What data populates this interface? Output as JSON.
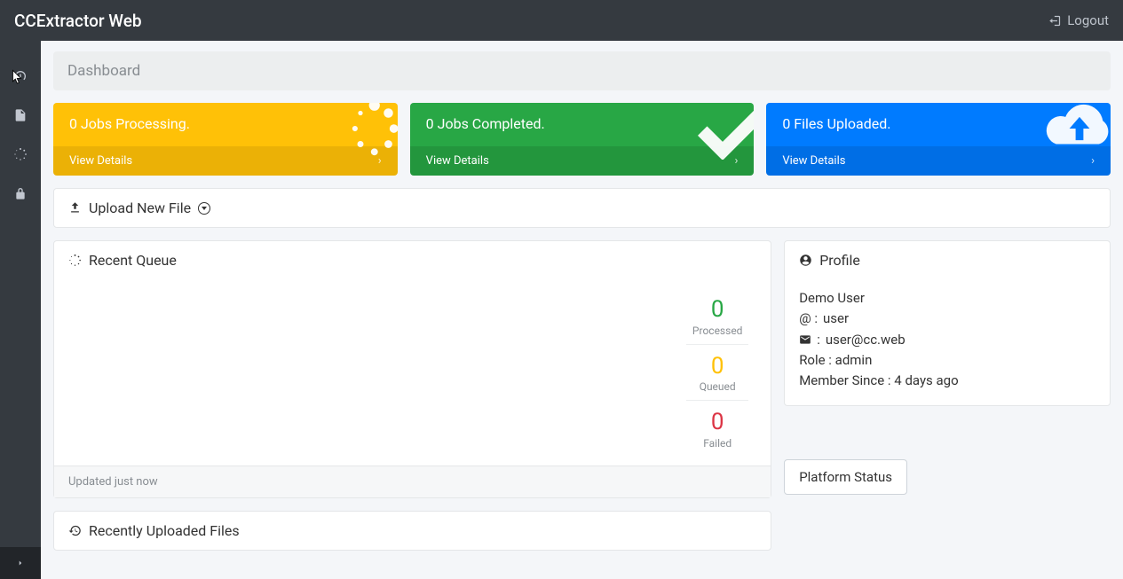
{
  "header": {
    "brand": "CCExtractor Web",
    "logout_label": "Logout"
  },
  "page": {
    "title": "Dashboard"
  },
  "cards": {
    "processing": {
      "title": "0 Jobs Processing.",
      "link": "View Details"
    },
    "completed": {
      "title": "0 Jobs Completed.",
      "link": "View Details"
    },
    "uploaded": {
      "title": "0 Files Uploaded.",
      "link": "View Details"
    }
  },
  "upload": {
    "label": "Upload New File"
  },
  "queue": {
    "title": "Recent Queue",
    "processed_value": "0",
    "processed_label": "Processed",
    "queued_value": "0",
    "queued_label": "Queued",
    "failed_value": "0",
    "failed_label": "Failed",
    "footer": "Updated just now"
  },
  "profile": {
    "title": "Profile",
    "name": "Demo User",
    "at_prefix": "@ :",
    "username": "user",
    "email_prefix": ":",
    "email": "user@cc.web",
    "role_line": "Role : admin",
    "member_line": "Member Since : 4 days ago"
  },
  "recent_files": {
    "title": "Recently Uploaded Files"
  },
  "platform": {
    "button": "Platform Status"
  }
}
